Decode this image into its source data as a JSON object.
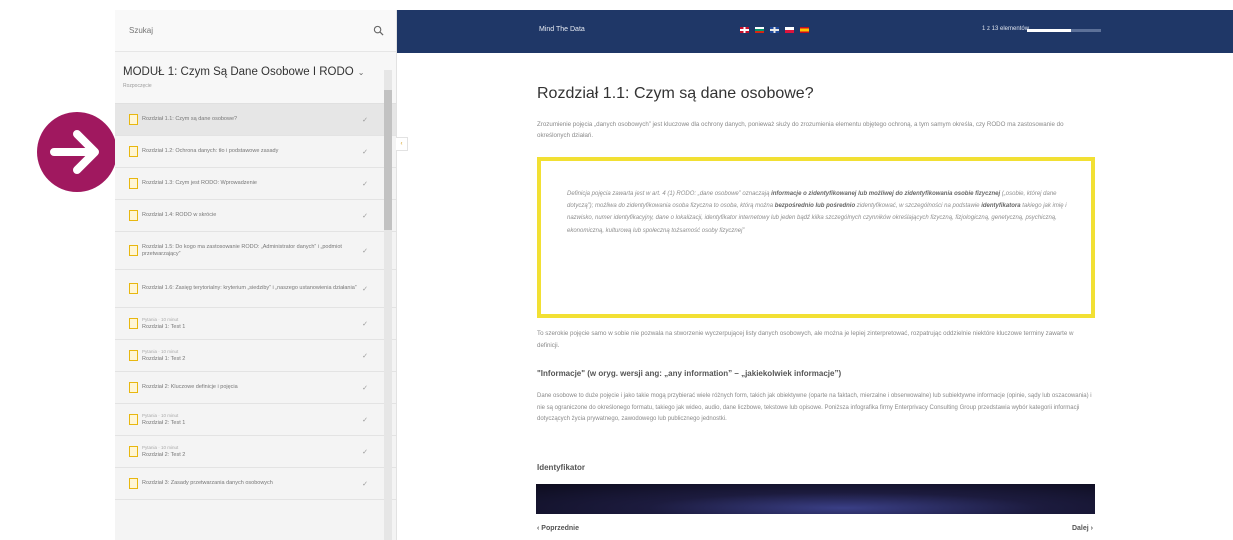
{
  "search": {
    "placeholder": "Szukaj"
  },
  "module": {
    "title": "MODUŁ 1: Czym Są Dane Osobowe I RODO",
    "subtitle": "Rozpoczęcie"
  },
  "sidebar": {
    "items": [
      {
        "label": "Rozdział 1.1: Czym są dane osobowe?",
        "meta": "",
        "active": true
      },
      {
        "label": "Rozdział 1.2: Ochrona danych: tło i podstawowe zasady",
        "meta": ""
      },
      {
        "label": "Rozdział 1.3: Czym jest RODO: Wprowadzenie",
        "meta": ""
      },
      {
        "label": "Rozdział 1.4: RODO w skrócie",
        "meta": ""
      },
      {
        "label": "Rozdział 1.5: Do kogo ma zastosowanie RODO: „Administrator danych” i „podmiot przetwarzający”",
        "meta": ""
      },
      {
        "label": "Rozdział 1.6: Zasięg terytorialny: kryterium „siedziby” i „naszego ustanowienia działania”",
        "meta": ""
      },
      {
        "label": "Rozdział 1: Test 1",
        "meta": "Pytania · 10 minut"
      },
      {
        "label": "Rozdział 1: Test 2",
        "meta": "Pytania · 10 minut"
      },
      {
        "label": "Rozdział 2: Kluczowe definicje i pojęcia",
        "meta": ""
      },
      {
        "label": "Rozdział 2: Test 1",
        "meta": "Pytania · 10 minut"
      },
      {
        "label": "Rozdział 2: Test 2",
        "meta": "Pytania · 10 minut"
      },
      {
        "label": "Rozdział 3: Zasady przetwarzania danych osobowych",
        "meta": ""
      }
    ]
  },
  "topbar": {
    "title": "Mind The Data",
    "count_text": "1 z 13 elementów",
    "progress_fraction": 0.6
  },
  "content": {
    "chapter_title": "Rozdział 1.1: Czym są dane osobowe?",
    "intro": "Zrozumienie pojęcia „danych osobowych” jest kluczowe dla ochrony danych, ponieważ służy do zrozumienia elementu objętego ochroną, a tym samym określa, czy RODO ma zastosowanie do określonych działań.",
    "quote_lead": "Definicja pojęcia zawarta jest w art. 4 (1) RODO: „dane osobowe” oznaczają ",
    "quote_bold1": "informacje o zidentyfikowanej lub możliwej do zidentyfikowania osobie fizycznej",
    "quote_mid1": " („osobie, której dane dotyczą”); możliwa do zidentyfikowania osoba fizyczna to osoba, którą można ",
    "quote_bold2": "bezpośrednio lub pośrednio",
    "quote_mid2": " zidentyfikować, w szczególności na podstawie ",
    "quote_bold3": "identyfikatora",
    "quote_end": " takiego jak imię i nazwisko, numer identyfikacyjny, dane o lokalizacji, identyfikator internetowy lub jeden bądź kilka szczególnych czynników określających fizyczną, fizjologiczną, genetyczną, psychiczną, ekonomiczną, kulturową lub społeczną tożsamość osoby fizycznej”",
    "para1": "To szerokie pojęcie samo w sobie nie pozwala na stworzenie wyczerpującej listy danych osobowych, ale można je lepiej zinterpretować, rozpatrując oddzielnie niektóre kluczowe terminy zawarte w definicji.",
    "subhead1": "\"Informacje\" (w oryg. wersji ang: „any information” – „jakiekolwiek informacje”)",
    "para2": "Dane osobowe to duże pojęcie i jako takie mogą przybierać wiele różnych form, takich jak obiektywne (oparte na faktach, mierzalne i obserwowalne) lub subiektywne informacje (opinie, sądy lub oszacowania) i nie są ograniczone do określonego formatu, takiego jak wideo, audio, dane liczbowe, tekstowe lub opisowe. Poniższa infografika firmy Enterprivacy Consulting Group przedstawia wybór kategorii informacji dotyczących życia prywatnego, zawodowego lub publicznego jednostki.",
    "subhead2": "Identyfikator",
    "prev_label": "‹ Poprzednie",
    "next_label": "Dalej ›"
  },
  "colors": {
    "topbar": "#1f3767",
    "accent_badge": "#a0185f",
    "quote_border": "#f2e033"
  }
}
